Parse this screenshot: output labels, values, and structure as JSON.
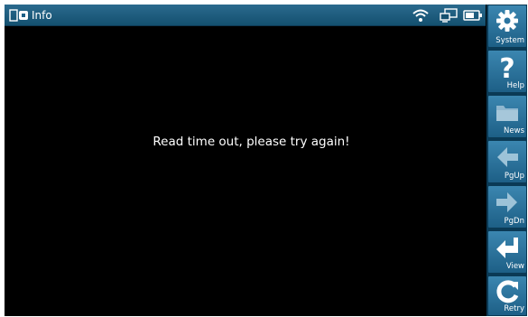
{
  "window": {
    "title": "Info"
  },
  "status_icons": [
    "wifi-icon",
    "monitor-icon",
    "battery-icon"
  ],
  "message": "Read time out, please try again!",
  "toolbar": {
    "system": "System",
    "help": "Help",
    "news": "News",
    "pgup": "PgUp",
    "pgdn": "PgDn",
    "view": "View",
    "retry": "Retry"
  },
  "colors": {
    "titlebar": "#1d5f86",
    "button": "#2b74a0",
    "background": "#000000",
    "text": "#ffffff"
  }
}
